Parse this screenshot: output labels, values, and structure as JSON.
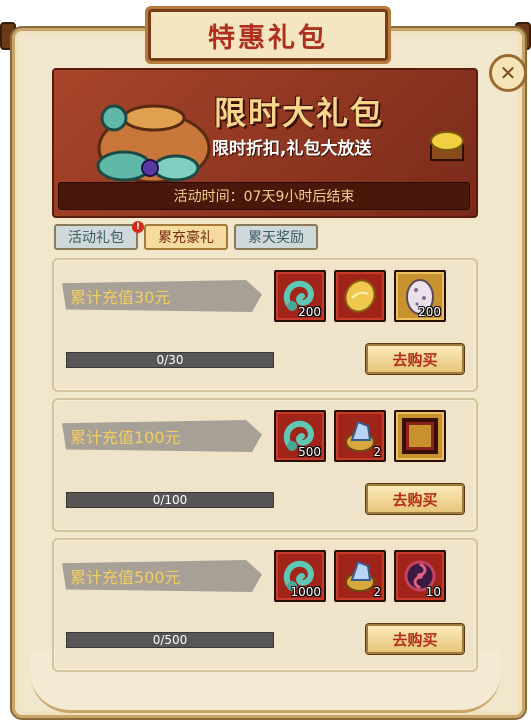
{
  "window": {
    "title": "特惠礼包"
  },
  "banner": {
    "title": "限时大礼包",
    "subtitle": "限时折扣,礼包大放送",
    "time_text": "活动时间：07天9小时后结束"
  },
  "tabs": [
    {
      "label": "活动礼包",
      "active": false,
      "badge": "!"
    },
    {
      "label": "累充豪礼",
      "active": true
    },
    {
      "label": "累天奖励",
      "active": false
    }
  ],
  "cards": [
    {
      "label": "累计充值30元",
      "progress": "0/30",
      "buy_label": "去购买",
      "items": [
        {
          "icon": "jade-dragon-icon",
          "count": "200",
          "frame": "red"
        },
        {
          "icon": "gold-ore-icon",
          "count": "",
          "frame": "red"
        },
        {
          "icon": "spotted-egg-icon",
          "count": "200",
          "frame": "gold"
        }
      ]
    },
    {
      "label": "累计充值100元",
      "progress": "0/100",
      "buy_label": "去购买",
      "items": [
        {
          "icon": "jade-dragon-icon",
          "count": "500",
          "frame": "red"
        },
        {
          "icon": "crystal-ore-icon",
          "count": "2",
          "frame": "red"
        },
        {
          "icon": "avatar-frame-icon",
          "count": "",
          "frame": "gold"
        }
      ]
    },
    {
      "label": "累计充值500元",
      "progress": "0/500",
      "buy_label": "去购买",
      "items": [
        {
          "icon": "jade-dragon-icon",
          "count": "1000",
          "frame": "red"
        },
        {
          "icon": "crystal-ore-icon",
          "count": "2",
          "frame": "red"
        },
        {
          "icon": "triple-swirl-icon",
          "count": "10",
          "frame": "red"
        }
      ]
    }
  ]
}
